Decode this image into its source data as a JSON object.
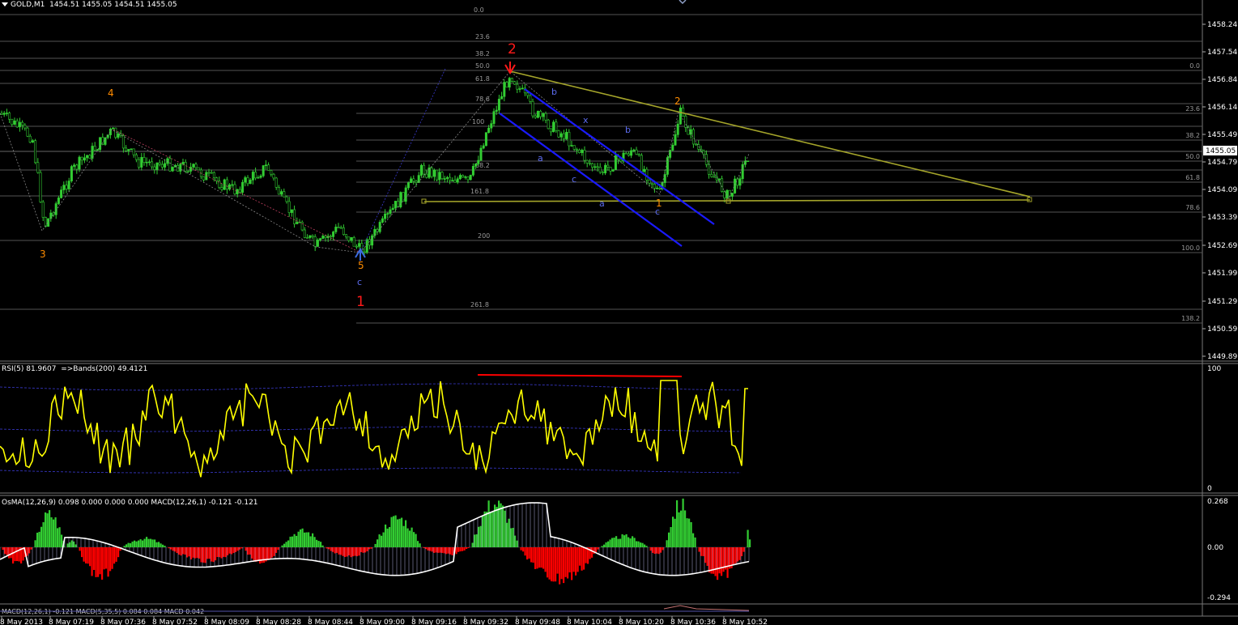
{
  "header": {
    "symbol": "GOLD,M1",
    "ohlc": "1454.51 1455.05 1454.51 1455.05"
  },
  "price_axis": {
    "ticks": [
      "1458.24",
      "1457.54",
      "1456.84",
      "1456.14",
      "1455.49",
      "1455.05",
      "1454.79",
      "1454.09",
      "1453.39",
      "1452.69",
      "1451.99",
      "1451.29",
      "1450.59",
      "1449.89"
    ],
    "current_price": "1455.05"
  },
  "fib_left": [
    "0.0",
    "23.6",
    "38.2",
    "50.0",
    "61.8",
    "78.6",
    "100",
    "38.2",
    "161.8",
    "200",
    "261.8"
  ],
  "fib_right": [
    "0.0",
    "23.6",
    "38.2",
    "50.0",
    "61.8",
    "78.6",
    "100.0",
    "138.2"
  ],
  "wave_labels": {
    "orange": [
      "4",
      "3",
      "5",
      "2",
      "1"
    ],
    "red": [
      "2",
      "1"
    ],
    "blue": [
      "c",
      "b",
      "a",
      "c",
      "x",
      "b",
      "a",
      "c"
    ]
  },
  "rsi": {
    "label": "RSI(5) 81.9607",
    "bands_label": "=>Bands(200) 49.4121",
    "axis_top": "100",
    "axis_bottom": "0"
  },
  "macd": {
    "label": "OsMA(12,26,9) 0.098 0.000 0.000 0.000  MACD(12,26,1) -0.121 -0.121",
    "axis": [
      "0.268",
      "0.00",
      "-0.294"
    ]
  },
  "footer_indicator": "MACD(12,26,1) -0.121  MACD(5,35,5) 0.084 0.084  MACD 0.042",
  "time_axis": [
    "8 May 2013",
    "8 May 07:19",
    "8 May 07:36",
    "8 May 07:52",
    "8 May 08:09",
    "8 May 08:28",
    "8 May 08:44",
    "8 May 09:00",
    "8 May 09:16",
    "8 May 09:32",
    "8 May 09:48",
    "8 May 10:04",
    "8 May 10:20",
    "8 May 10:36",
    "8 May 10:52"
  ],
  "colors": {
    "bull": "#32cd32",
    "bear": "#ff0000",
    "rsi_line": "#ffff00",
    "trend_line": "#a4a42a",
    "channel": "#1a1aff",
    "wave_orange": "#ff8c00",
    "wave_red": "#ff1a1a",
    "wave_blue": "#5c6cf0"
  }
}
